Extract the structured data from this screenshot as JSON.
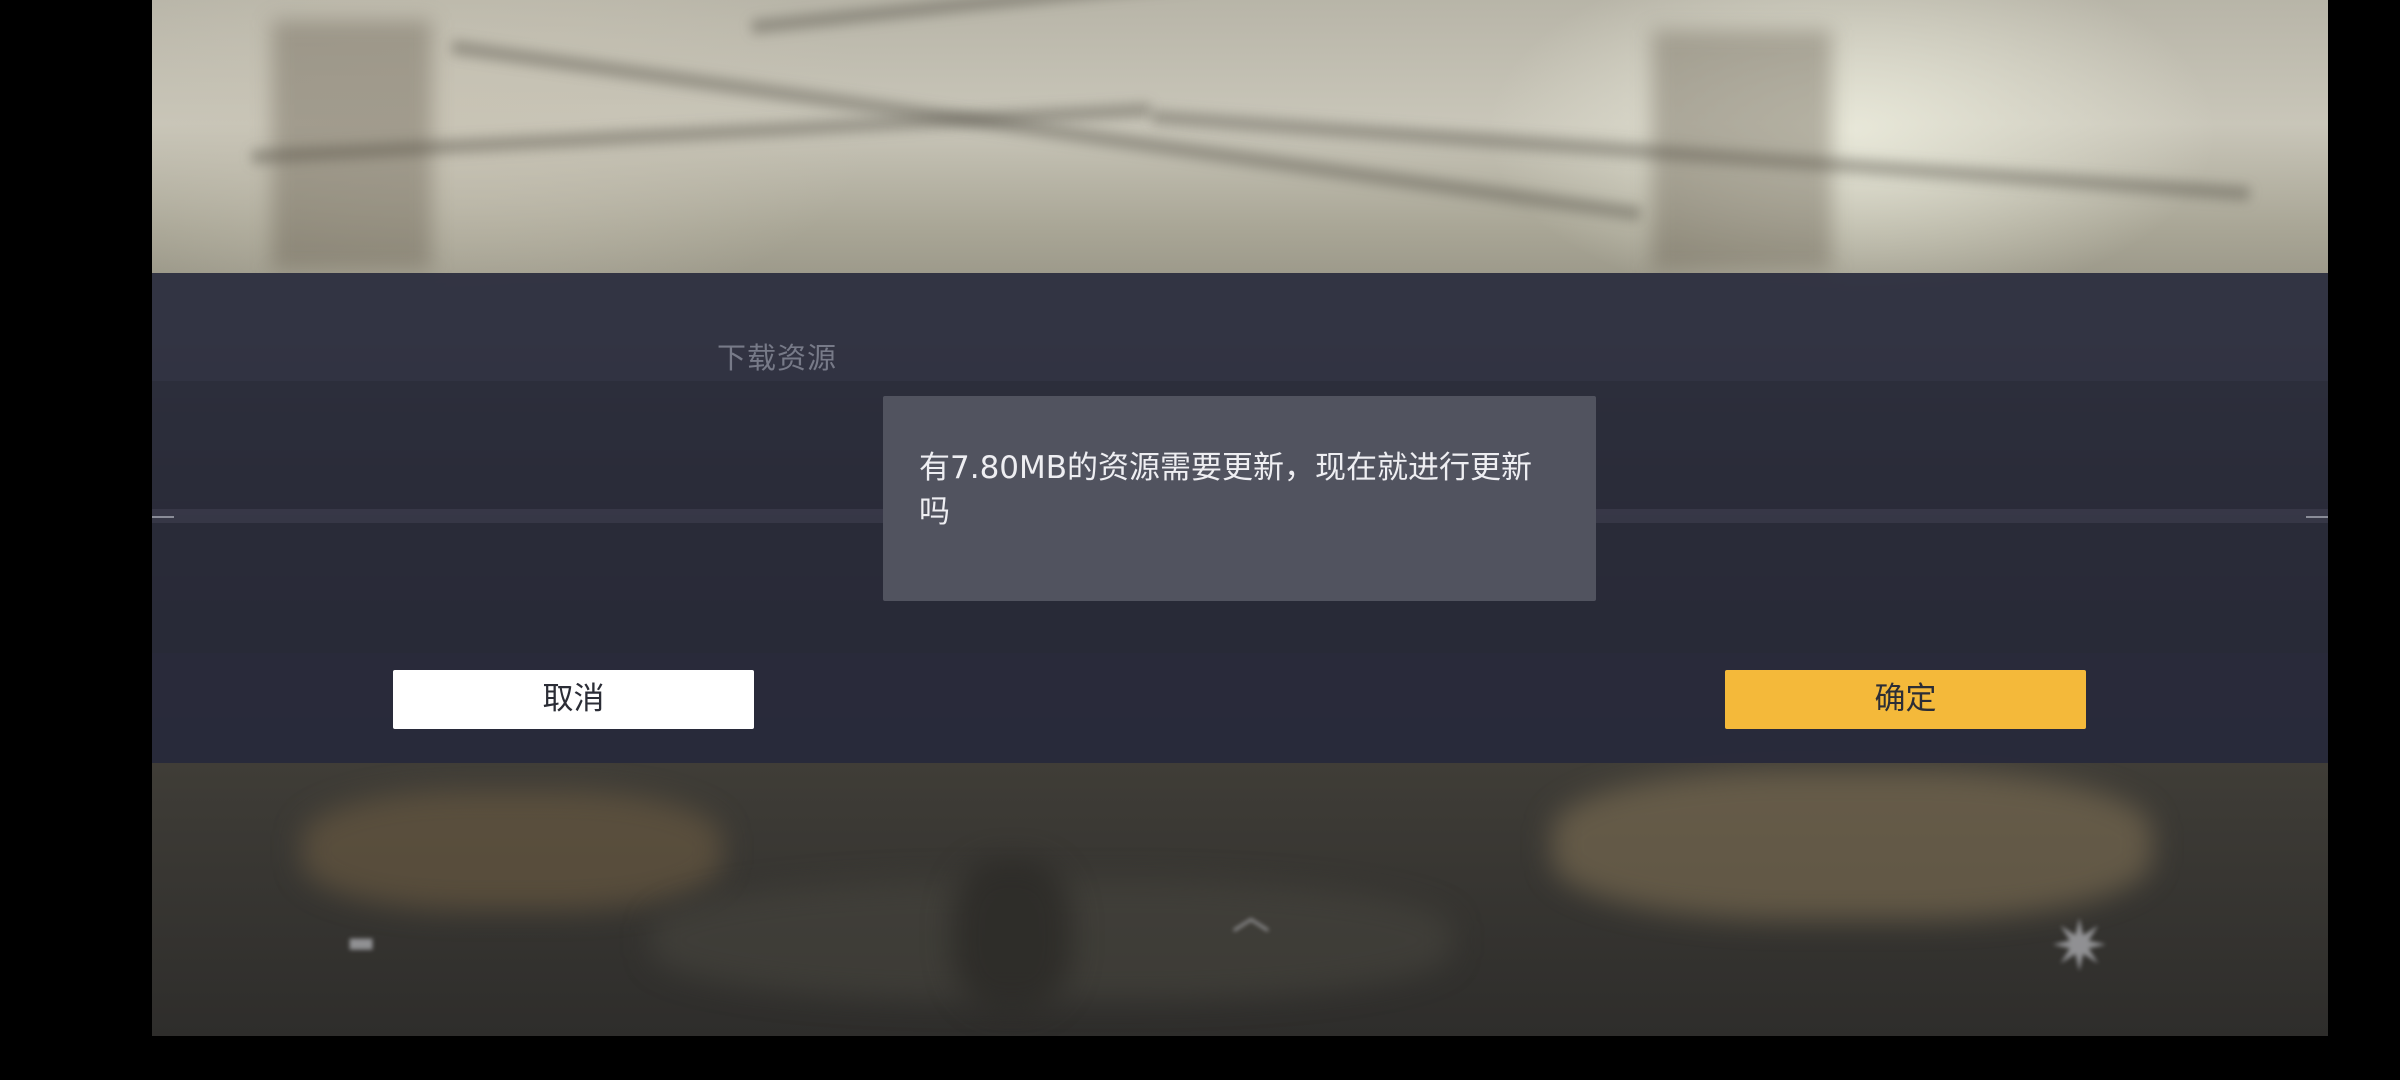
{
  "dialog": {
    "title": "下载资源",
    "message": "有7.80MB的资源需要更新，现在就进行更新吗",
    "cancel_label": "取消",
    "confirm_label": "确定"
  },
  "colors": {
    "confirm_button": "#f4b93a",
    "cancel_button": "#ffffff",
    "dialog_band": "#262837",
    "message_box": "#51535f"
  },
  "icons": {
    "hud_bottom_right": "star-icon",
    "hud_bottom_center": "arrow-up-icon"
  }
}
